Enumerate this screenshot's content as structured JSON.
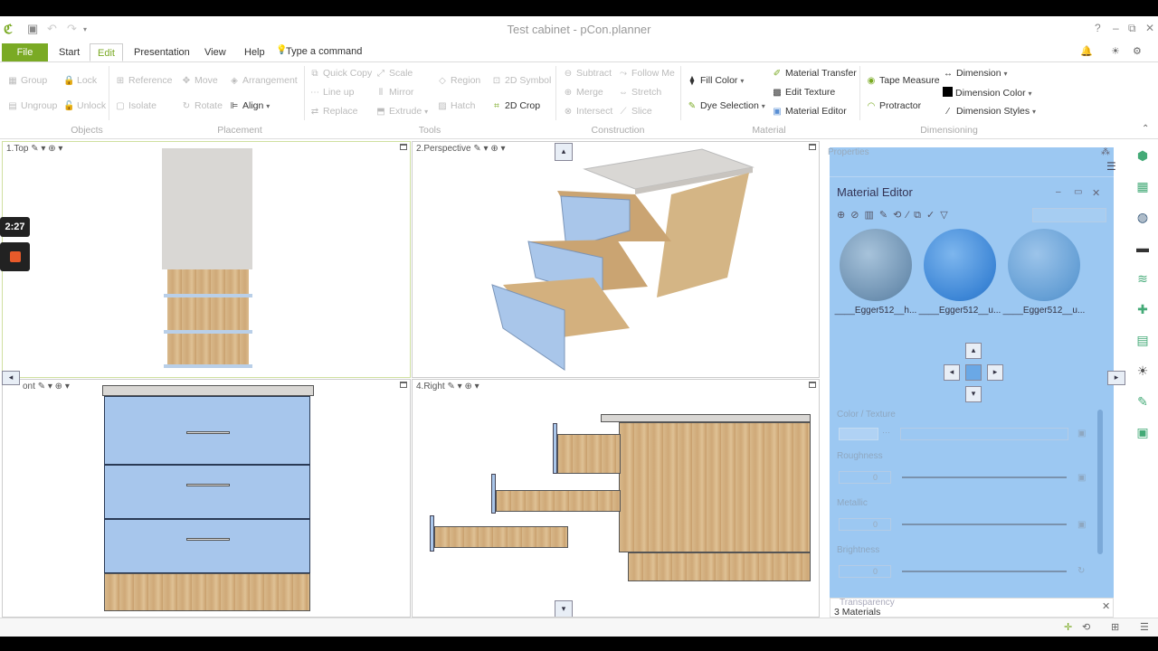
{
  "window": {
    "title": "Test cabinet - pCon.planner",
    "controls": [
      "?",
      "–",
      "⧉",
      "✕"
    ]
  },
  "menu": {
    "tabs": [
      "File",
      "Start",
      "Edit",
      "Presentation",
      "View",
      "Help"
    ],
    "active_tab": "Edit",
    "command_placeholder": "Type a command"
  },
  "ribbon": {
    "objects": {
      "label": "Objects",
      "group": "Group",
      "lock": "Lock",
      "ungroup": "Ungroup",
      "unlock": "Unlock"
    },
    "placement": {
      "label": "Placement",
      "reference": "Reference",
      "move": "Move",
      "arrangement": "Arrangement",
      "isolate": "Isolate",
      "rotate": "Rotate",
      "align": "Align"
    },
    "tools": {
      "label": "Tools",
      "quick_copy": "Quick Copy",
      "scale": "Scale",
      "region": "Region",
      "line_up": "Line up",
      "mirror": "Mirror",
      "replace": "Replace",
      "extrude": "Extrude",
      "hatch": "Hatch",
      "symbol_2d": "2D Symbol",
      "crop_2d": "2D Crop"
    },
    "construction": {
      "label": "Construction",
      "subtract": "Subtract",
      "follow_me": "Follow Me",
      "merge": "Merge",
      "stretch": "Stretch",
      "intersect": "Intersect",
      "slice": "Slice"
    },
    "material": {
      "label": "Material",
      "fill_color": "Fill Color",
      "dye_selection": "Dye Selection",
      "material_transfer": "Material Transfer",
      "edit_texture": "Edit Texture",
      "material_editor": "Material Editor"
    },
    "dimensioning": {
      "label": "Dimensioning",
      "tape_measure": "Tape Measure",
      "protractor": "Protractor",
      "dimension": "Dimension",
      "dimension_color": "Dimension Color",
      "dimension_styles": "Dimension Styles"
    }
  },
  "viewports": {
    "top": "1.Top",
    "perspective": "2.Perspective",
    "front": "ont",
    "right": "4.Right"
  },
  "overlay": {
    "timer": "2:27"
  },
  "properties": {
    "title": "Properties",
    "material_editor": {
      "title": "Material Editor",
      "materials": [
        {
          "label": "____Egger512__h...",
          "color": "#7fa6c8"
        },
        {
          "label": "____Egger512__u...",
          "color": "#4a8fd9"
        },
        {
          "label": "____Egger512__u...",
          "color": "#6ea3d4"
        }
      ],
      "sections": {
        "color_texture": "Color / Texture",
        "roughness": "Roughness",
        "metallic": "Metallic",
        "brightness": "Brightness",
        "transparency": "Transparency"
      },
      "values": {
        "roughness": "0",
        "metallic": "0",
        "brightness": "0"
      },
      "count_label": "3 Materials"
    }
  }
}
